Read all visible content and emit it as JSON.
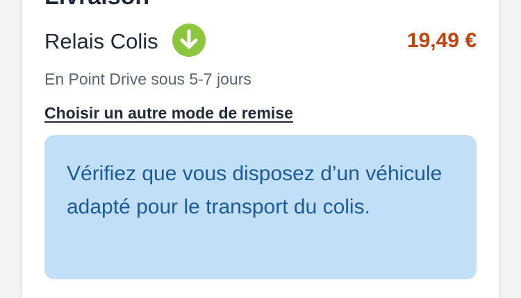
{
  "delivery": {
    "section_title": "Livraison",
    "carrier_name": "Relais Colis",
    "carrier_icon": "arrow-down-circle-icon",
    "price": "19,49 €",
    "description": "En Point Drive sous 5-7 jours",
    "change_link": "Choisir un autre mode de remise",
    "notice": "Vérifiez que vous disposez d’un véhicule adapté pour le transport du colis."
  },
  "colors": {
    "price": "#c2410c",
    "icon": "#8cc63f",
    "notice_bg": "#c2dff8",
    "notice_text": "#1d5b94"
  }
}
